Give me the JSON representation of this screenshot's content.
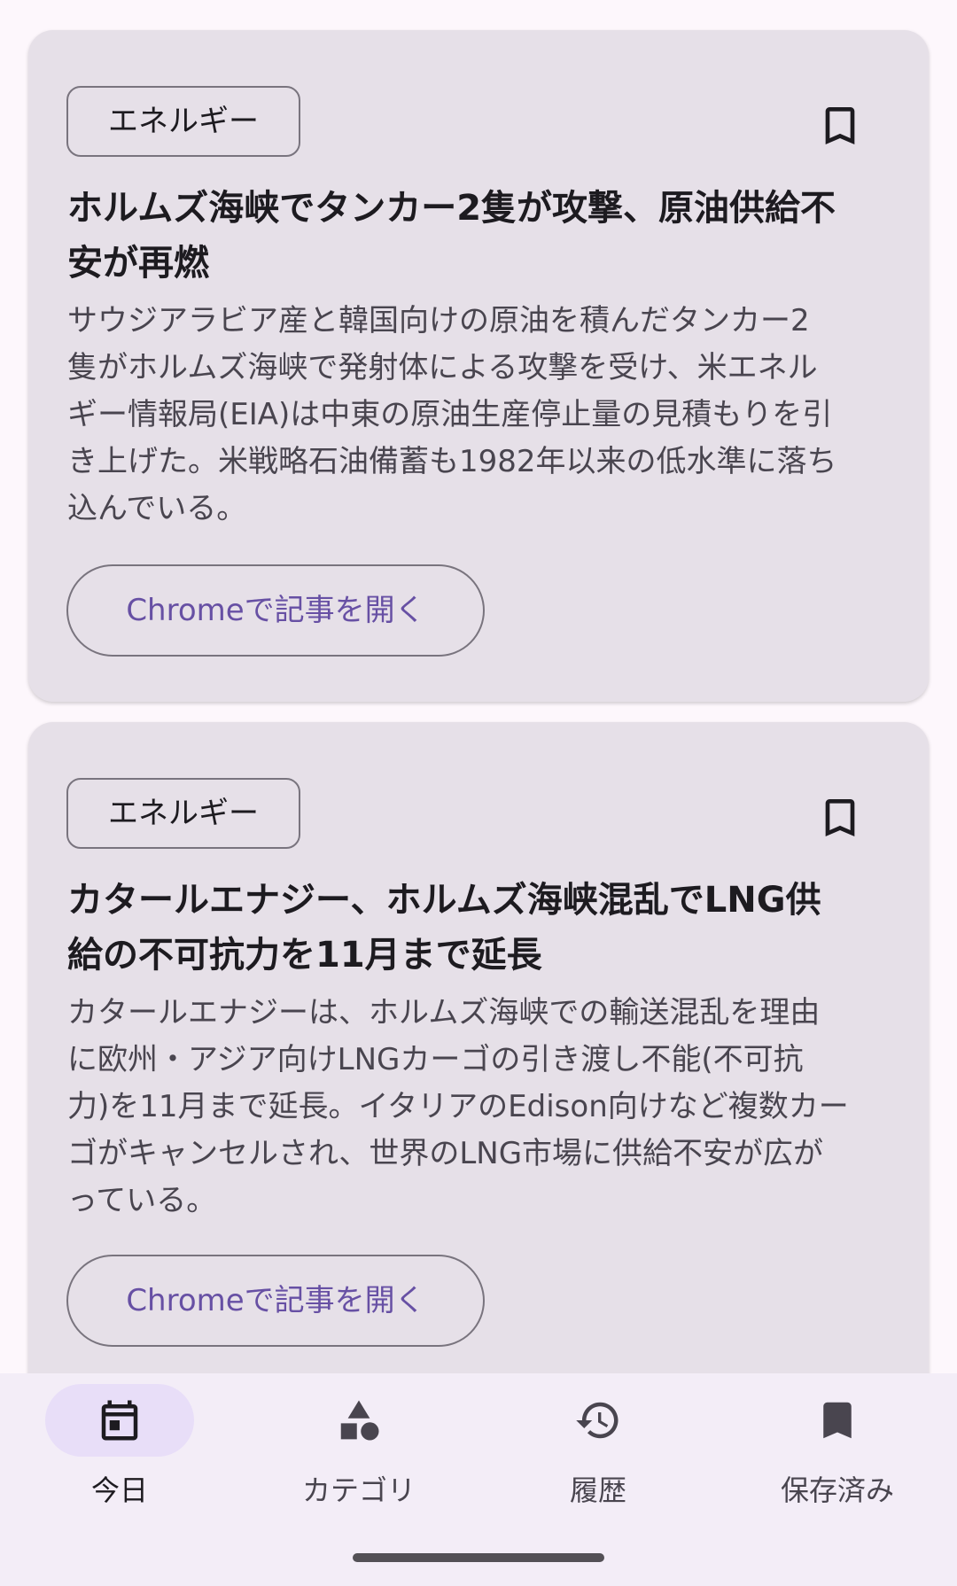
{
  "articles": [
    {
      "category": "エネルギー",
      "title_line1": "ホルムズ海峡でタンカー2隻が攻撃、原油供給不",
      "title_line2": "安が再燃",
      "summary_lines": [
        "サウジアラビア産と韓国向けの原油を積んだタンカー2",
        "隻がホルムズ海峡で発射体による攻撃を受け、米エネル",
        "ギー情報局(EIA)は中東の原油生産停止量の見積もりを引",
        "き上げた。米戦略石油備蓄も1982年以来の低水準に落ち",
        "込んでいる。"
      ],
      "open_label": "Chromeで記事を開く",
      "bookmark_icon": "bookmark-outline-icon"
    },
    {
      "category": "エネルギー",
      "title_line1": "カタールエナジー、ホルムズ海峡混乱でLNG供",
      "title_line2": "給の不可抗力を11月まで延長",
      "summary_lines": [
        "カタールエナジーは、ホルムズ海峡での輸送混乱を理由",
        "に欧州・アジア向けLNGカーゴの引き渡し不能(不可抗",
        "力)を11月まで延長。イタリアのEdison向けなど複数カー",
        "ゴがキャンセルされ、世界のLNG市場に供給不安が広が",
        "っている。"
      ],
      "open_label": "Chromeで記事を開く",
      "bookmark_icon": "bookmark-outline-icon"
    }
  ],
  "bottom_nav": {
    "items": [
      {
        "label": "今日",
        "icon": "calendar-today-icon",
        "active": true
      },
      {
        "label": "カテゴリ",
        "icon": "category-shapes-icon",
        "active": false
      },
      {
        "label": "履歴",
        "icon": "history-icon",
        "active": false
      },
      {
        "label": "保存済み",
        "icon": "bookmark-filled-icon",
        "active": false
      }
    ]
  },
  "colors": {
    "background": "#fdf7fc",
    "card": "#e6e0e8",
    "accent": "#6750a4",
    "nav_background": "#f3edf7",
    "nav_active_pill": "#e8def8"
  }
}
